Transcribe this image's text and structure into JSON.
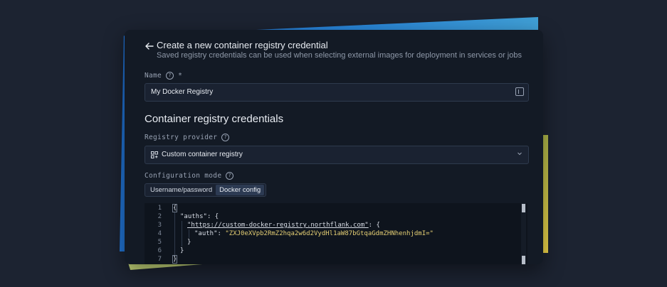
{
  "page": {
    "title": "Create a new container registry credential",
    "subtitle": "Saved registry credentials can be used when selecting external images for deployment in services or jobs"
  },
  "name_field": {
    "label": "Name",
    "required_mark": "*",
    "value": "My Docker Registry"
  },
  "section": {
    "title": "Container registry credentials"
  },
  "registry_provider": {
    "label": "Registry provider",
    "selected": "Custom container registry"
  },
  "configuration_mode": {
    "label": "Configuration mode",
    "options": [
      "Username/password",
      "Docker config"
    ],
    "active": "Docker config"
  },
  "editor": {
    "line_numbers": [
      "1",
      "2",
      "3",
      "4",
      "5",
      "6",
      "7"
    ],
    "lines": {
      "l1": "{",
      "l2_key": "\"auths\"",
      "l2_rest": ": {",
      "l3_url": "\"https://custom-docker-registry.northflank.com\"",
      "l3_rest": ": {",
      "l4_key": "\"auth\"",
      "l4_sep": ": ",
      "l4_value": "\"ZXJ0eXVpb2RmZ2hqa2w6d2VydHl1aW87bGtqaGdmZHNhenhjdmI=\"",
      "l5": "}",
      "l6": "}",
      "l7": "}"
    }
  },
  "colors": {
    "background": "#1c2331",
    "panel": "#131a25",
    "accent_blue": "#2a87d8",
    "accent_yellow": "#f1d64a",
    "string": "#e5cf74"
  },
  "icons": {
    "back": "arrow-left-icon",
    "help": "question-circle-icon",
    "input_action": "sidebar-panel-icon",
    "registry": "container-registry-icon",
    "dropdown": "chevron-down-icon"
  }
}
